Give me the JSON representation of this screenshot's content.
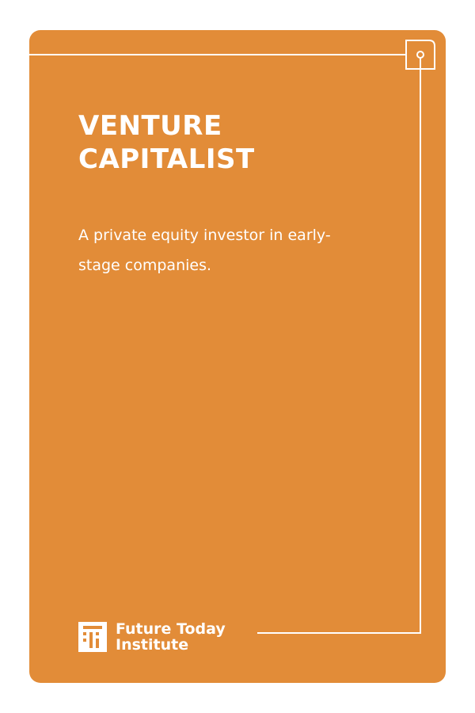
{
  "card": {
    "title_lines": [
      "VENTURE",
      "CAPITALIST"
    ],
    "description": "A private equity investor in early-stage companies.",
    "background_color": "#E28C38",
    "text_color": "#FFFFFF"
  },
  "brand": {
    "name_lines": [
      "Future Today",
      "Institute"
    ],
    "logo_icon": "future-today-institute-logo"
  }
}
